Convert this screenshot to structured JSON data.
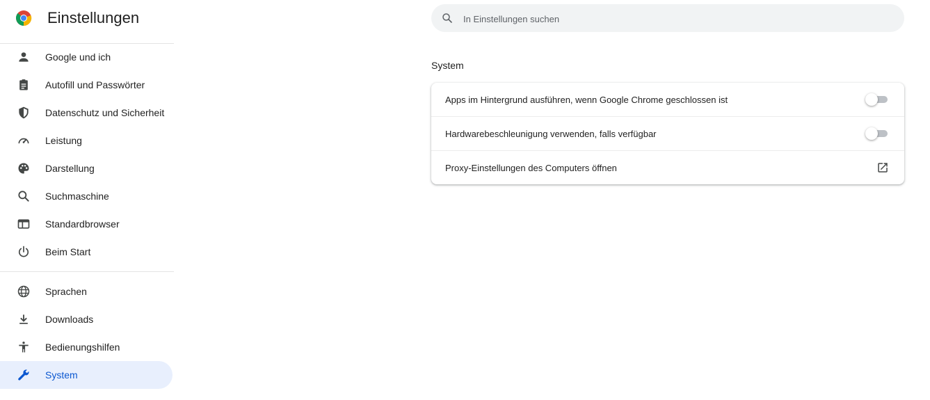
{
  "header": {
    "title": "Einstellungen"
  },
  "search": {
    "placeholder": "In Einstellungen suchen"
  },
  "sidebar": {
    "items": [
      {
        "label": "Google und ich",
        "icon": "person-icon"
      },
      {
        "label": "Autofill und Passwörter",
        "icon": "clipboard-icon"
      },
      {
        "label": "Datenschutz und Sicherheit",
        "icon": "shield-icon"
      },
      {
        "label": "Leistung",
        "icon": "speedometer-icon"
      },
      {
        "label": "Darstellung",
        "icon": "palette-icon"
      },
      {
        "label": "Suchmaschine",
        "icon": "search-icon"
      },
      {
        "label": "Standardbrowser",
        "icon": "browser-window-icon"
      },
      {
        "label": "Beim Start",
        "icon": "power-icon"
      }
    ],
    "advanced_items": [
      {
        "label": "Sprachen",
        "icon": "globe-icon"
      },
      {
        "label": "Downloads",
        "icon": "download-icon"
      },
      {
        "label": "Bedienungshilfen",
        "icon": "accessibility-icon"
      },
      {
        "label": "System",
        "icon": "wrench-icon",
        "active": true
      }
    ]
  },
  "main": {
    "section_title": "System",
    "rows": [
      {
        "label": "Apps im Hintergrund ausführen, wenn Google Chrome geschlossen ist",
        "control": "toggle",
        "enabled": false
      },
      {
        "label": "Hardwarebeschleunigung verwenden, falls verfügbar",
        "control": "toggle",
        "enabled": false
      },
      {
        "label": "Proxy-Einstellungen des Computers öffnen",
        "control": "external-link-icon"
      }
    ]
  },
  "colors": {
    "accent": "#0b57d0",
    "active_bg": "#e8effd",
    "icon": "#5f6368"
  }
}
